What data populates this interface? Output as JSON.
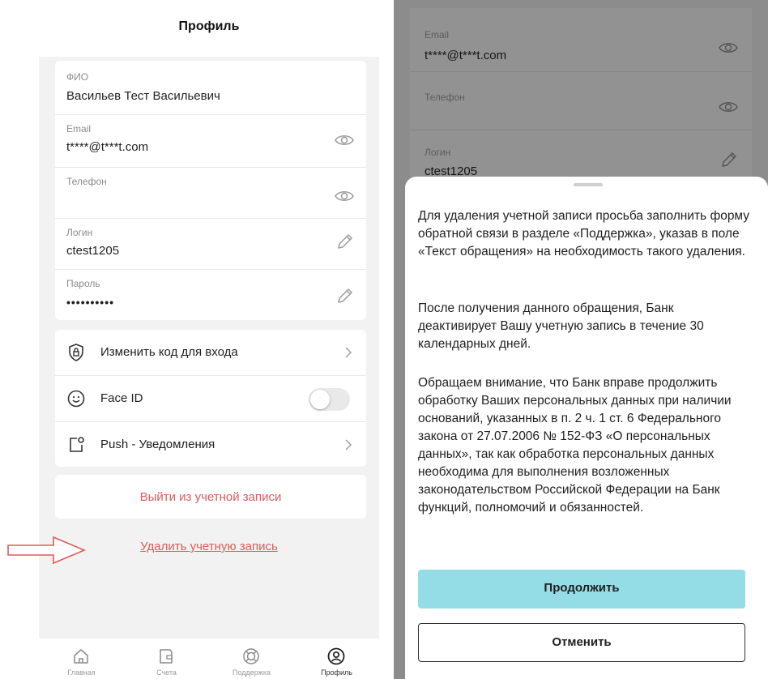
{
  "left_screen": {
    "title": "Профиль",
    "fields": {
      "fio": {
        "label": "ФИО",
        "value": "Васильев Тест Васильевич"
      },
      "email": {
        "label": "Email",
        "value": "t****@t***t.com"
      },
      "phone": {
        "label": "Телефон",
        "value": ""
      },
      "login": {
        "label": "Логин",
        "value": "ctest1205"
      },
      "password": {
        "label": "Пароль",
        "value": "••••••••••"
      }
    },
    "menu": {
      "change_code": "Изменить код для входа",
      "face_id": "Face ID",
      "push": "Push - Уведомления"
    },
    "face_id_enabled": false,
    "logout": "Выйти из учетной записи",
    "delete_account": "Удалить учетную запись",
    "tabs": {
      "home": "Главная",
      "accounts": "Счета",
      "support": "Поддержка",
      "profile": "Профиль"
    },
    "active_tab": "Профиль"
  },
  "right_screen": {
    "background_fields": {
      "email": {
        "label": "Email",
        "value": "t****@t***t.com"
      },
      "phone": {
        "label": "Телефон",
        "value": ""
      },
      "login": {
        "label": "Логин",
        "value": "ctest1205"
      }
    },
    "sheet": {
      "paragraph_1": "Для удаления учетной записи просьба заполнить форму обратной связи в разделе «Поддержка», указав в поле «Текст обращения» на необходимость такого удаления.",
      "paragraph_2": "После получения данного обращения, Банк деактивирует Вашу учетную запись в течение 30 календарных дней.",
      "paragraph_3": "Обращаем внимание, что Банк вправе продолжить обработку Ваших персональных данных при наличии оснований, указанных в п. 2 ч. 1 ст. 6 Федерального закона от 27.07.2006 № 152-ФЗ «О персональных данных», так как обработка персональных данных необходима для выполнения возложенных законодательством Российской Федерации на Банк функций, полномочий и обязанностей.",
      "continue_label": "Продолжить",
      "cancel_label": "Отменить"
    }
  },
  "colors": {
    "accent_red": "#e05a5a",
    "primary_button": "#94dde6",
    "screen_background": "#f2f2f2",
    "overlay": "#8c8c8c"
  },
  "icons": [
    "eye-icon",
    "pencil-icon",
    "lock-shield-icon",
    "smile-icon",
    "push-notification-icon",
    "chevron-right-icon",
    "home-icon",
    "wallet-icon",
    "lifebuoy-icon",
    "profile-icon",
    "red-arrow-icon"
  ]
}
